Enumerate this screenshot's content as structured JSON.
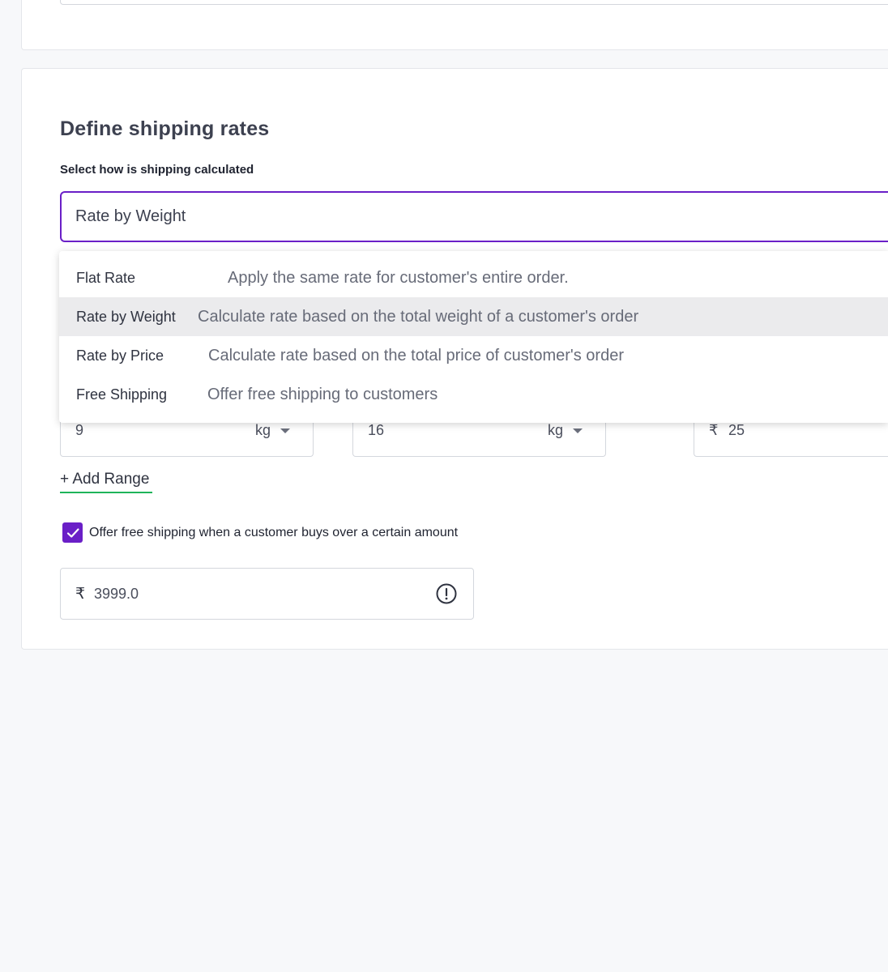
{
  "section": {
    "title": "Define shipping rates",
    "select_label": "Select how is shipping calculated",
    "selected_value": "Rate by Weight"
  },
  "dropdown": {
    "options": [
      {
        "name": "Flat Rate",
        "description": "Apply the same rate for customer's entire order."
      },
      {
        "name": "Rate by Weight",
        "description": "Calculate rate based on the total weight of a customer's order"
      },
      {
        "name": "Rate by Price",
        "description": "Calculate rate based on the total price of customer's order"
      },
      {
        "name": "Free Shipping",
        "description": "Offer free shipping to customers"
      }
    ],
    "highlighted_option": "Rate by Weight"
  },
  "range": {
    "from_value": "9",
    "from_unit": "kg",
    "to_value": "16",
    "to_unit": "kg",
    "rate_currency": "₹",
    "rate_value": "25"
  },
  "add_range_label": "+ Add Range",
  "free_shipping": {
    "checked": true,
    "label": "Offer free shipping when a customer buys over a certain amount",
    "currency": "₹",
    "amount": "3999.0"
  },
  "colors": {
    "accent": "#6a1fc7",
    "link_underline": "#1fb45a",
    "highlight_bg": "#ebebed"
  },
  "icons": {
    "checkbox": "check-icon",
    "amount_warning": "alert-circle-icon",
    "unit_dropdown": "caret-down-icon"
  }
}
